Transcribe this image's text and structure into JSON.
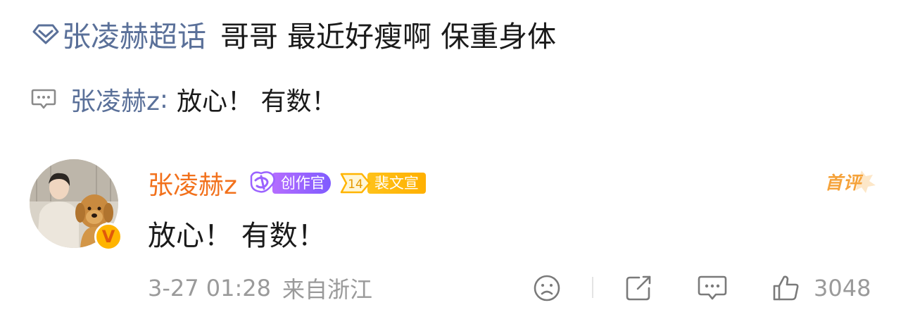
{
  "post": {
    "topic_icon": "supertopic-diamond-icon",
    "topic_label": "张凌赫超话",
    "text": "哥哥 最近好瘦啊  保重身体"
  },
  "reply_preview": {
    "icon": "comment-bubble-icon",
    "author": "张凌赫z",
    "separator": ":",
    "text": "放心！ 有数！"
  },
  "comment": {
    "avatar": "avatar-photo",
    "verified_icon": "verified-v-icon",
    "verified_glyph": "V",
    "username": "张凌赫z",
    "badges": [
      {
        "icon": "creator-ribbon-icon",
        "label": "创作官"
      },
      {
        "icon": "fan-level-icon",
        "level": "14",
        "label": "裴文宣"
      }
    ],
    "first_comment_label": "首评",
    "text": "放心！ 有数！",
    "time": "3-27 01:28",
    "location": "来自浙江",
    "actions": {
      "dislike_icon": "sad-face-icon",
      "share_icon": "share-icon",
      "reply_icon": "comment-icon",
      "like_icon": "thumbs-up-icon",
      "like_count": "3048"
    }
  },
  "colors": {
    "link_blue": "#5a7099",
    "username_orange": "#f2711c",
    "meta_gray": "#9a9a9a",
    "creator_purple": "#9b63ff",
    "fan_gold": "#ffb400"
  }
}
